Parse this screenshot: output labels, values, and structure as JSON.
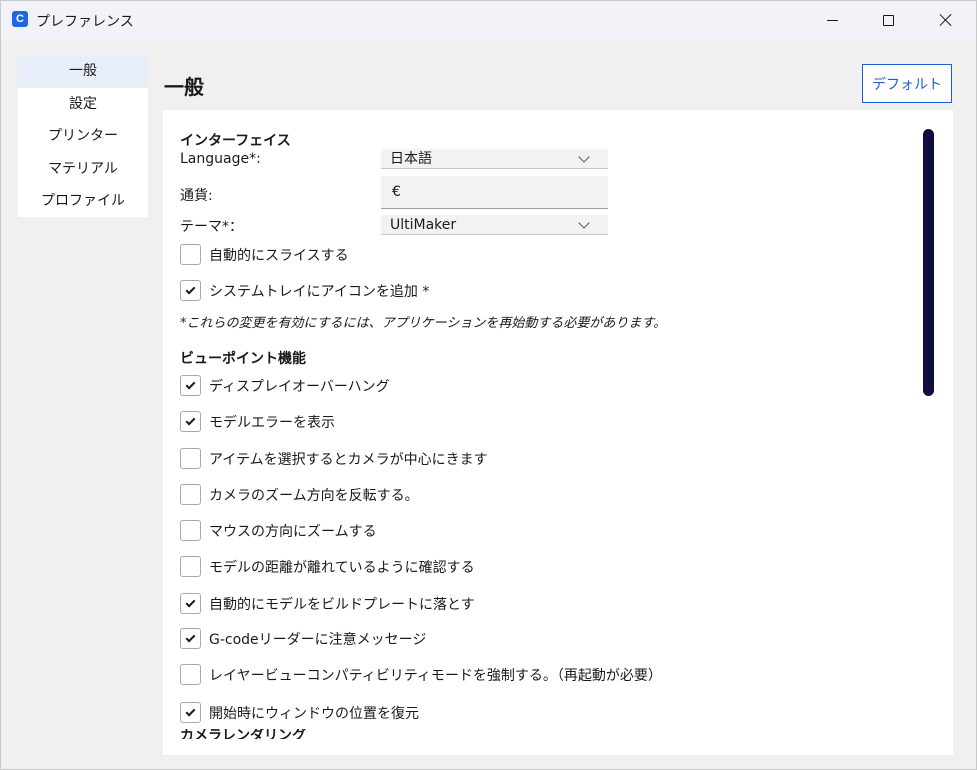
{
  "window": {
    "title": "プレファレンス",
    "app_icon_letter": "C",
    "accent": "#1b5fd4"
  },
  "sidebar": {
    "items": [
      {
        "label": "一般",
        "active": true
      },
      {
        "label": "設定",
        "active": false
      },
      {
        "label": "プリンター",
        "active": false
      },
      {
        "label": "マテリアル",
        "active": false
      },
      {
        "label": "プロファイル",
        "active": false
      }
    ]
  },
  "page": {
    "title": "一般",
    "default_button": "デフォルト"
  },
  "interface": {
    "header": "インターフェイス",
    "language_label": "Language*:",
    "language_value": "日本語",
    "currency_label": "通貨:",
    "currency_value": "€",
    "theme_label": "テーマ*：",
    "theme_value": "UltiMaker",
    "auto_slice_label": "自動的にスライスする",
    "auto_slice_checked": false,
    "tray_icon_label": "システムトレイにアイコンを追加 *",
    "tray_icon_checked": true,
    "restart_note": "*これらの変更を有効にするには、アプリケーションを再始動する必要があります。"
  },
  "viewport": {
    "header": "ビューポイント機能",
    "options": [
      {
        "label": "ディスプレイオーバーハング",
        "checked": true
      },
      {
        "label": "モデルエラーを表示",
        "checked": true
      },
      {
        "label": "アイテムを選択するとカメラが中心にきます",
        "checked": false
      },
      {
        "label": "カメラのズーム方向を反転する。",
        "checked": false
      },
      {
        "label": "マウスの方向にズームする",
        "checked": false
      },
      {
        "label": "モデルの距離が離れているように確認する",
        "checked": false
      },
      {
        "label": "自動的にモデルをビルドプレートに落とす",
        "checked": true
      },
      {
        "label": "G-codeリーダーに注意メッセージ",
        "checked": true
      },
      {
        "label": "レイヤービューコンパティビリティモードを強制する。（再起動が必要）",
        "checked": false
      },
      {
        "label": "開始時にウィンドウの位置を復元",
        "checked": true
      }
    ],
    "next_header_partial": "カメラレンダリング"
  }
}
